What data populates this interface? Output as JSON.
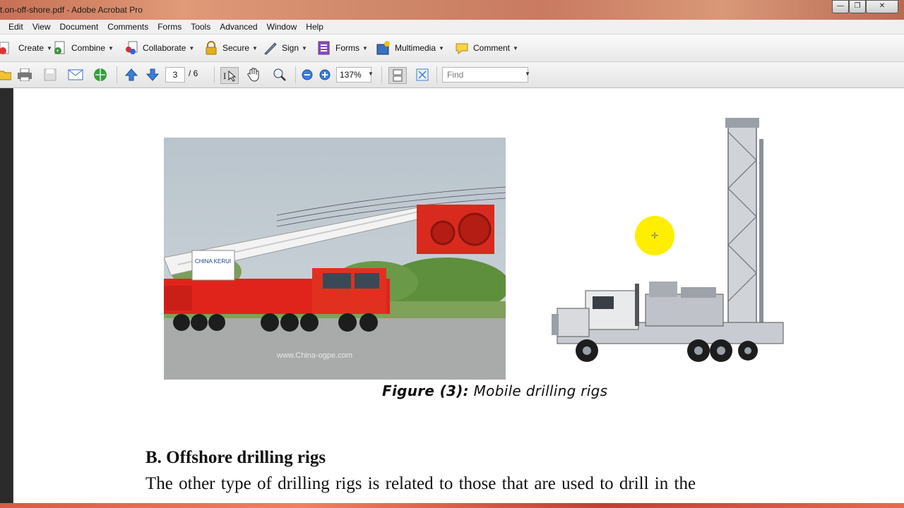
{
  "window": {
    "title": "t.on-off-shore.pdf - Adobe Acrobat Pro",
    "controls": {
      "minimize": "—",
      "maximize": "❐",
      "close": "✕"
    }
  },
  "menu": [
    "Edit",
    "View",
    "Document",
    "Comments",
    "Forms",
    "Tools",
    "Advanced",
    "Window",
    "Help"
  ],
  "tasks": [
    {
      "label": "Create",
      "icon": "create-icon"
    },
    {
      "label": "Combine",
      "icon": "combine-icon"
    },
    {
      "label": "Collaborate",
      "icon": "collaborate-icon"
    },
    {
      "label": "Secure",
      "icon": "lock-icon"
    },
    {
      "label": "Sign",
      "icon": "pen-icon"
    },
    {
      "label": "Forms",
      "icon": "forms-icon"
    },
    {
      "label": "Multimedia",
      "icon": "multimedia-icon"
    },
    {
      "label": "Comment",
      "icon": "comment-icon"
    }
  ],
  "navigation": {
    "current_page": "3",
    "total_pages": "/ 6",
    "zoom": "137%",
    "find_placeholder": "Find"
  },
  "document": {
    "figure_caption_bold": "Figure (3):",
    "figure_caption_text": " Mobile drilling rigs",
    "section_heading": "B. Offshore drilling rigs",
    "paragraph": "The other type of drilling rigs is related to those that are used to drill in the",
    "photo1_watermark": "www.China-ogpe.com",
    "truck_label": "CHINA KERUI"
  },
  "colors": {
    "rig_red": "#e0241c",
    "highlight_cursor": "#ffee00"
  }
}
